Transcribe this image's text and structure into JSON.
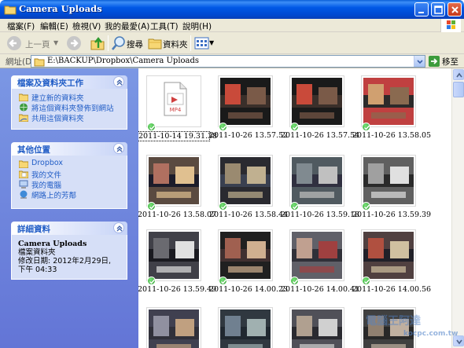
{
  "window": {
    "title": "Camera Uploads",
    "buttons": [
      "minimize",
      "maximize",
      "close"
    ]
  },
  "menu": [
    "檔案(F)",
    "編輯(E)",
    "檢視(V)",
    "我的最愛(A)",
    "工具(T)",
    "說明(H)"
  ],
  "toolbar": {
    "back_label": "上一頁",
    "search_label": "搜尋",
    "folders_label": "資料夾"
  },
  "address": {
    "label": "網址(D)",
    "path": "E:\\BACKUP\\Dropbox\\Camera Uploads",
    "go_label": "移至"
  },
  "tasks": {
    "title": "檔案及資料夾工作",
    "items": [
      "建立新的資料夾",
      "將這個資料夾發佈到網站",
      "共用這個資料夾"
    ]
  },
  "places": {
    "title": "其他位置",
    "items": [
      "Dropbox",
      "我的文件",
      "我的電腦",
      "網路上的芳鄰"
    ]
  },
  "details": {
    "title": "詳細資料",
    "name": "Camera Uploads",
    "type": "檔案資料夾",
    "modified": "修改日期: 2012年2月29日, 下午 04:33"
  },
  "files": [
    {
      "name": "2011-10-14 19.31.38",
      "kind": "mp4",
      "selected": true
    },
    {
      "name": "2011-10-26 13.57.52",
      "kind": "photo-a"
    },
    {
      "name": "2011-10-26 13.57.54",
      "kind": "photo-a"
    },
    {
      "name": "2011-10-26 13.58.05",
      "kind": "photo-b"
    },
    {
      "name": "2011-10-26 13.58.07",
      "kind": "photo-c"
    },
    {
      "name": "2011-10-26 13.58.44",
      "kind": "photo-d"
    },
    {
      "name": "2011-10-26 13.59.18",
      "kind": "photo-e"
    },
    {
      "name": "2011-10-26 13.59.39",
      "kind": "photo-f"
    },
    {
      "name": "2011-10-26 13.59.49",
      "kind": "photo-g"
    },
    {
      "name": "2011-10-26 14.00.23",
      "kind": "photo-h"
    },
    {
      "name": "2011-10-26 14.00.41",
      "kind": "photo-i"
    },
    {
      "name": "2011-10-26 14.00.56",
      "kind": "photo-j"
    },
    {
      "name": "",
      "kind": "photo-k"
    },
    {
      "name": "",
      "kind": "photo-l"
    },
    {
      "name": "",
      "kind": "photo-m"
    },
    {
      "name": "",
      "kind": "photo-n"
    }
  ],
  "mp4_badge": "MP4",
  "watermark": {
    "line1": "電腦王阿達",
    "line2": "kocpc.com.tw"
  }
}
